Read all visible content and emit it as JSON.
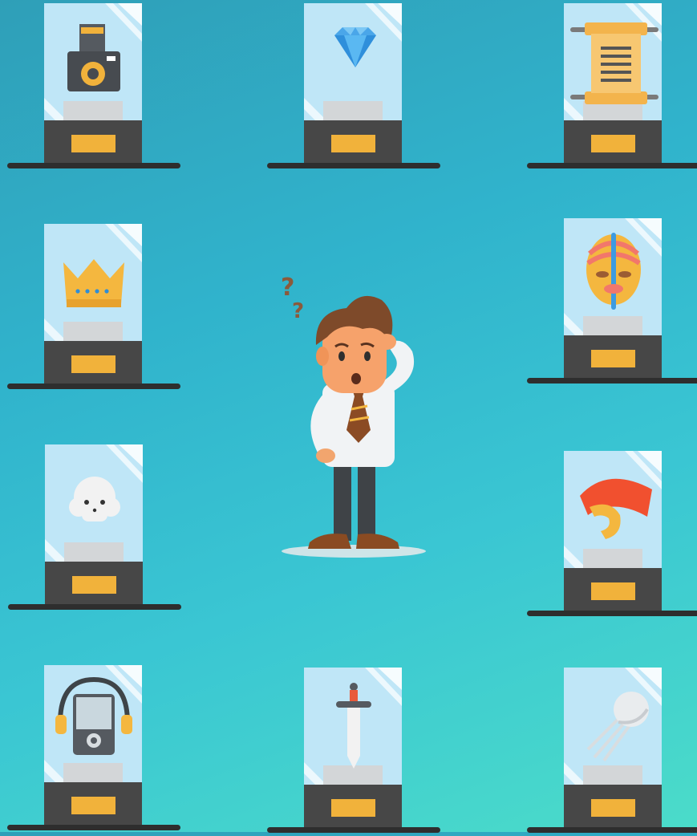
{
  "scene": {
    "background_top": "#2f9fb8",
    "background_bottom": "#4bdcc9",
    "exhibits": [
      {
        "item": "camera-icon",
        "slot": "top-left"
      },
      {
        "item": "diamond-icon",
        "slot": "top-center"
      },
      {
        "item": "scroll-icon",
        "slot": "top-right"
      },
      {
        "item": "crown-icon",
        "slot": "middle-left-upper"
      },
      {
        "item": "tribal-mask-icon",
        "slot": "middle-right-upper"
      },
      {
        "item": "skull-icon",
        "slot": "middle-left-lower"
      },
      {
        "item": "spartan-helmet-icon",
        "slot": "middle-right-lower"
      },
      {
        "item": "walkman-icon",
        "slot": "bottom-left"
      },
      {
        "item": "sword-icon",
        "slot": "bottom-center"
      },
      {
        "item": "sputnik-satellite-icon",
        "slot": "bottom-right"
      }
    ],
    "character": {
      "name": "confused-businessman",
      "expression": "puzzled"
    }
  }
}
